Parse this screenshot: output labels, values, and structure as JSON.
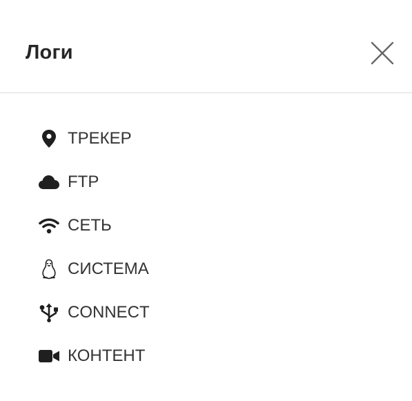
{
  "dialog": {
    "title": "Логи",
    "close_label": "×"
  },
  "menu": {
    "items": [
      {
        "label": "ТРЕКЕР",
        "icon": "map-marker-icon"
      },
      {
        "label": "FTP",
        "icon": "cloud-icon"
      },
      {
        "label": "СЕТЬ",
        "icon": "wifi-icon"
      },
      {
        "label": "СИСТЕМА",
        "icon": "linux-penguin-icon"
      },
      {
        "label": "CONNECT",
        "icon": "usb-icon"
      },
      {
        "label": "КОНТЕНТ",
        "icon": "video-camera-icon"
      }
    ]
  },
  "colors": {
    "text": "#333333",
    "title": "#262626",
    "icon": "#1f1f1f",
    "close": "#666666",
    "divider": "#dcdcdc",
    "background": "#ffffff"
  }
}
